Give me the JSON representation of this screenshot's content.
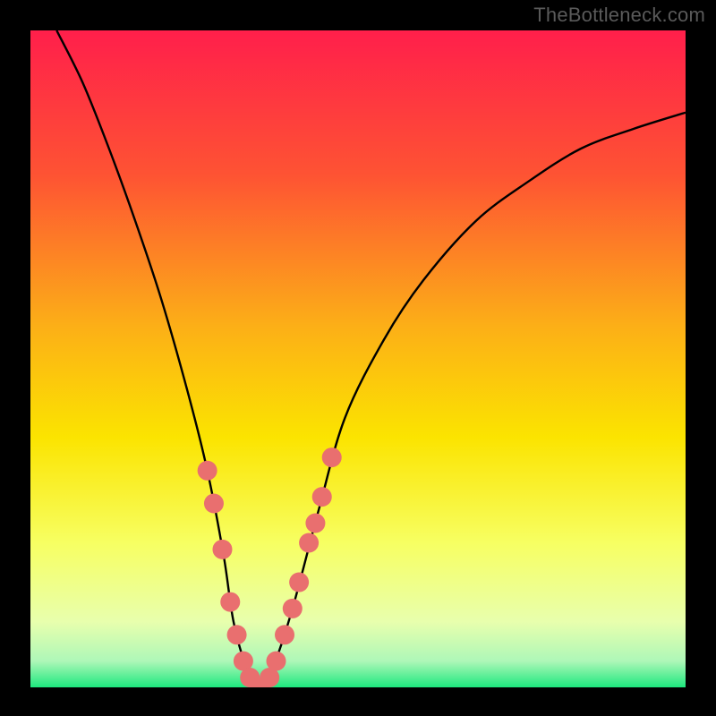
{
  "watermark": "TheBottleneck.com",
  "chart_data": {
    "type": "line",
    "title": "",
    "xlabel": "",
    "ylabel": "",
    "xlim": [
      0,
      100
    ],
    "ylim": [
      0,
      100
    ],
    "x": [
      4,
      8,
      12,
      16,
      20,
      24,
      27,
      29.5,
      31,
      33,
      35,
      37,
      40,
      44,
      48,
      54,
      60,
      68,
      76,
      84,
      92,
      100
    ],
    "values": [
      100,
      92,
      82,
      71,
      59,
      45,
      33,
      20,
      10,
      3,
      0,
      3,
      12,
      27,
      41,
      53,
      62,
      71,
      77,
      82,
      85,
      87.5
    ],
    "gradient_stops": [
      {
        "offset": 0.0,
        "color": "#ff1f4b"
      },
      {
        "offset": 0.22,
        "color": "#fe5333"
      },
      {
        "offset": 0.45,
        "color": "#fcaf17"
      },
      {
        "offset": 0.62,
        "color": "#fbe400"
      },
      {
        "offset": 0.78,
        "color": "#f7ff62"
      },
      {
        "offset": 0.9,
        "color": "#e8ffad"
      },
      {
        "offset": 0.96,
        "color": "#aef7b8"
      },
      {
        "offset": 1.0,
        "color": "#1ee87e"
      }
    ],
    "markers": [
      {
        "x": 27.0,
        "y": 33
      },
      {
        "x": 28.0,
        "y": 28
      },
      {
        "x": 29.3,
        "y": 21
      },
      {
        "x": 30.5,
        "y": 13
      },
      {
        "x": 31.5,
        "y": 8
      },
      {
        "x": 32.5,
        "y": 4
      },
      {
        "x": 33.5,
        "y": 1.5
      },
      {
        "x": 35.0,
        "y": 0
      },
      {
        "x": 36.5,
        "y": 1.5
      },
      {
        "x": 37.5,
        "y": 4
      },
      {
        "x": 38.8,
        "y": 8
      },
      {
        "x": 40.0,
        "y": 12
      },
      {
        "x": 41.0,
        "y": 16
      },
      {
        "x": 42.5,
        "y": 22
      },
      {
        "x": 43.5,
        "y": 25
      },
      {
        "x": 44.5,
        "y": 29
      },
      {
        "x": 46.0,
        "y": 35
      }
    ],
    "marker_color": "#e96f6f",
    "marker_radius": 11
  }
}
